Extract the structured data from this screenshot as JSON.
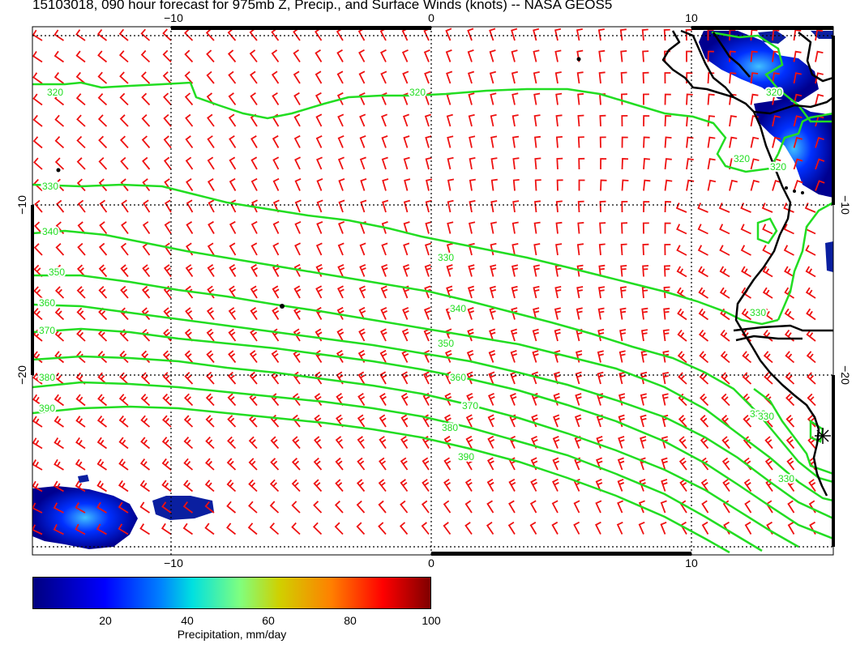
{
  "title": "15103018, 090 hour forecast for 975mb Z, Precip., and Surface Winds (knots) -- NASA GEOS5",
  "axes": {
    "top_ticks": [
      "−10",
      "0",
      "10"
    ],
    "bottom_ticks": [
      "−10",
      "0",
      "10"
    ],
    "left_ticks": [
      "−10",
      "−20"
    ],
    "right_ticks": [
      "−10",
      "−20"
    ]
  },
  "contour_labels": [
    "320",
    "320",
    "320",
    "320",
    "320",
    "330",
    "330",
    "330",
    "330",
    "340",
    "340",
    "350",
    "350",
    "360",
    "360",
    "370",
    "370",
    "380",
    "380",
    "390",
    "390",
    "330",
    "330"
  ],
  "colorbar": {
    "ticks": [
      "20",
      "40",
      "60",
      "80",
      "100"
    ],
    "label": "Precipitation, mm/day"
  },
  "colors": {
    "contour": "#22dd22",
    "wind_barbs": "#ee1111",
    "coast": "#000000",
    "precip_low": "#00007f",
    "precip_high": "#7f0000"
  }
}
